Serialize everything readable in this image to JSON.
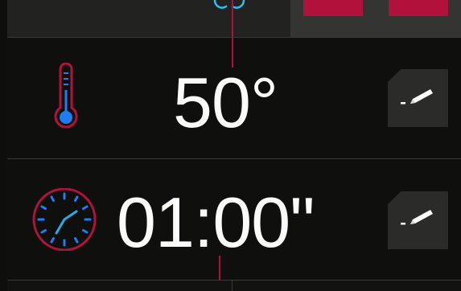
{
  "colors": {
    "background": "#0f100d",
    "accent": "#b0123c",
    "temperature_icon": "#1c7ef2",
    "timer_hands": "#29a9e6",
    "top_icon": "#2fc1ec",
    "edit_button": "#2b2c2a"
  },
  "top_bar": {
    "icons": [
      "steam-icon"
    ],
    "tabs": [
      "tab-left",
      "tab-right"
    ]
  },
  "temperature": {
    "icon": "thermometer-icon",
    "value": "50°",
    "edit_icon": "pencil-icon"
  },
  "timer": {
    "icon": "clock-icon",
    "value": "01:00\"",
    "edit_icon": "pencil-icon"
  }
}
